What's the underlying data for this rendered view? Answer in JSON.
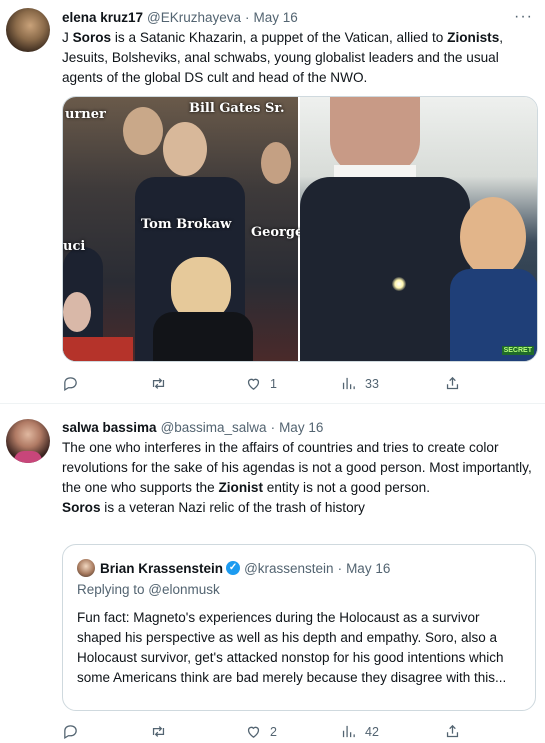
{
  "tweets": [
    {
      "name": "elena kruz17",
      "handle": "@EKruzhayeva",
      "dot": "·",
      "date": "May 16",
      "more": "···",
      "text_parts": [
        "J ",
        "Soros",
        " is a Satanic Khazarin, a puppet of the Vatican, allied to ",
        "Zionists",
        ", Jesuits, Bolsheviks, anal schwabs, young globalist leaders and the usual agents of the global DS cult and head of the NWO."
      ],
      "media": {
        "left_labels": [
          "urner",
          "Bill Gates Sr.",
          "Tom Brokaw",
          "George",
          "uci"
        ],
        "right_badge": "SECRET"
      },
      "stats": {
        "replies": "",
        "retweets": "",
        "likes": "1",
        "views": "33"
      }
    },
    {
      "name": "salwa bassima",
      "handle": "@bassima_salwa",
      "dot": "·",
      "date": "May 16",
      "text_parts": [
        "The one who interferes in the affairs of countries and tries to create color revolutions for the sake of his agendas is not a good person. Most importantly, the one who supports the ",
        "Zionist",
        " entity  is not a good person."
      ],
      "text_line2_parts": [
        "Soros",
        " is a veteran Nazi relic of the trash of history"
      ],
      "quote": {
        "name": "Brian Krassenstein",
        "verified": "✓",
        "handle": "@krassenstein",
        "dot": "·",
        "date": "May 16",
        "replying_prefix": "Replying to ",
        "replying_to": "@elonmusk",
        "text": "Fun fact:  Magneto's experiences during the Holocaust as a survivor shaped his perspective as well as his depth and empathy.  Soro, also a Holocaust survivor, get's attacked nonstop for his good intentions which some Americans think are bad merely because they disagree with this..."
      },
      "stats": {
        "replies": "",
        "retweets": "",
        "likes": "2",
        "views": "42"
      }
    }
  ],
  "icons": [
    "reply-icon",
    "retweet-icon",
    "like-icon",
    "views-icon",
    "share-icon"
  ],
  "colors": {
    "text": "#0f1419",
    "muted": "#536471",
    "border": "#cfd9de",
    "verified": "#1d9bf0"
  }
}
